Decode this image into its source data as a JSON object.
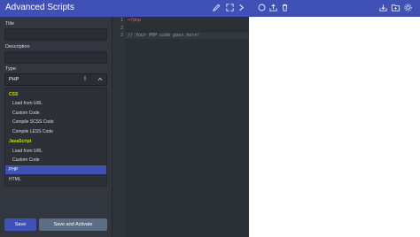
{
  "app": {
    "title": "Advanced Scripts"
  },
  "icons": {
    "edit": "pencil-icon",
    "expand": "expand-icon",
    "next": "chevron-right-icon",
    "circle": "circle-icon",
    "upload": "upload-icon",
    "delete": "trash-icon",
    "export": "export-icon",
    "folder": "folder-plus-icon",
    "settings": "gear-icon"
  },
  "form": {
    "title_label": "Title",
    "description_label": "Description",
    "type_label": "Type",
    "type_value": "PHP"
  },
  "dropdown": {
    "items": [
      {
        "kind": "group",
        "label": "CSS"
      },
      {
        "kind": "option",
        "label": "Load from URL"
      },
      {
        "kind": "option",
        "label": "Custom Code"
      },
      {
        "kind": "option",
        "label": "Compile SCSS Code"
      },
      {
        "kind": "option",
        "label": "Compile LESS Code"
      },
      {
        "kind": "group",
        "label": "JavaScript"
      },
      {
        "kind": "option",
        "label": "Load from URL"
      },
      {
        "kind": "option",
        "label": "Custom Code"
      },
      {
        "kind": "top",
        "label": "PHP",
        "selected": true
      },
      {
        "kind": "top",
        "label": "HTML"
      }
    ]
  },
  "buttons": {
    "save": "Save",
    "save_activate": "Save and Activate"
  },
  "editor": {
    "lines": [
      {
        "number": "1",
        "text": "<?php",
        "style": "tag"
      },
      {
        "number": "2",
        "text": "",
        "style": "plain"
      },
      {
        "number": "3",
        "text": "// Your PHP code goes here!",
        "style": "comment"
      }
    ]
  },
  "colors": {
    "accent": "#3f51b5",
    "group_label": "#c4e000",
    "php_tag": "#e0688a"
  }
}
